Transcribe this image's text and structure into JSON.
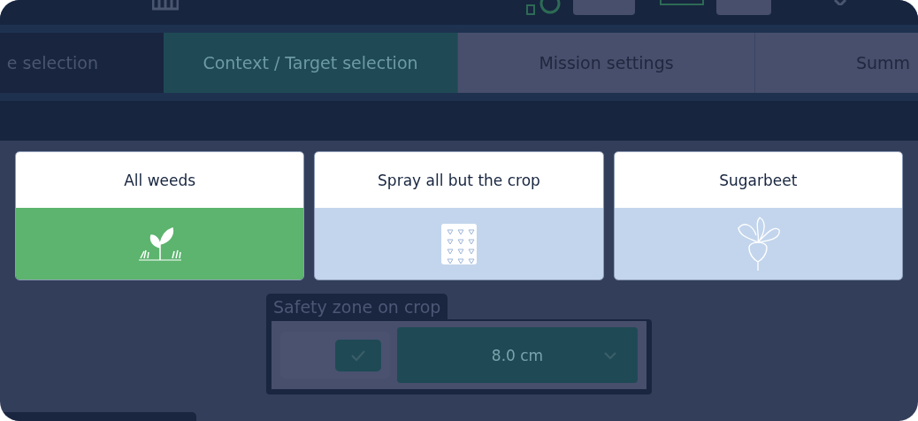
{
  "steps": [
    {
      "label": "e selection",
      "selected": false,
      "completed": true
    },
    {
      "label": "Context / Target selection",
      "selected": true,
      "completed": false
    },
    {
      "label": "Mission settings",
      "selected": false,
      "completed": false
    },
    {
      "label": "Summ",
      "selected": false,
      "completed": false
    }
  ],
  "targets": [
    {
      "label": "All weeds",
      "kind": "weeds",
      "selected": true
    },
    {
      "label": "Spray all but the crop",
      "kind": "grid",
      "selected": false
    },
    {
      "label": "Sugarbeet",
      "kind": "beet",
      "selected": false
    }
  ],
  "safety_zone": {
    "title": "Safety zone on crop",
    "checked": true,
    "value": "8.0 cm"
  }
}
